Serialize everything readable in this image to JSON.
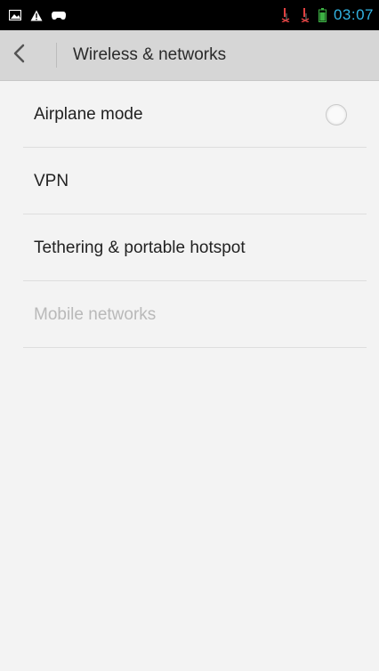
{
  "status_bar": {
    "left_icons": [
      "picture-notification-icon",
      "warning-icon",
      "gamepad-icon"
    ],
    "right_icons": [
      "no-signal-icon-1",
      "no-signal-icon-2",
      "battery-icon"
    ],
    "time": "03:07",
    "accent_color": "#33b5e5"
  },
  "action_bar": {
    "title": "Wireless & networks"
  },
  "settings": {
    "items": [
      {
        "label": "Airplane mode",
        "enabled": true,
        "toggle": "off"
      },
      {
        "label": "VPN",
        "enabled": true
      },
      {
        "label": "Tethering & portable hotspot",
        "enabled": true
      },
      {
        "label": "Mobile networks",
        "enabled": false
      }
    ]
  }
}
